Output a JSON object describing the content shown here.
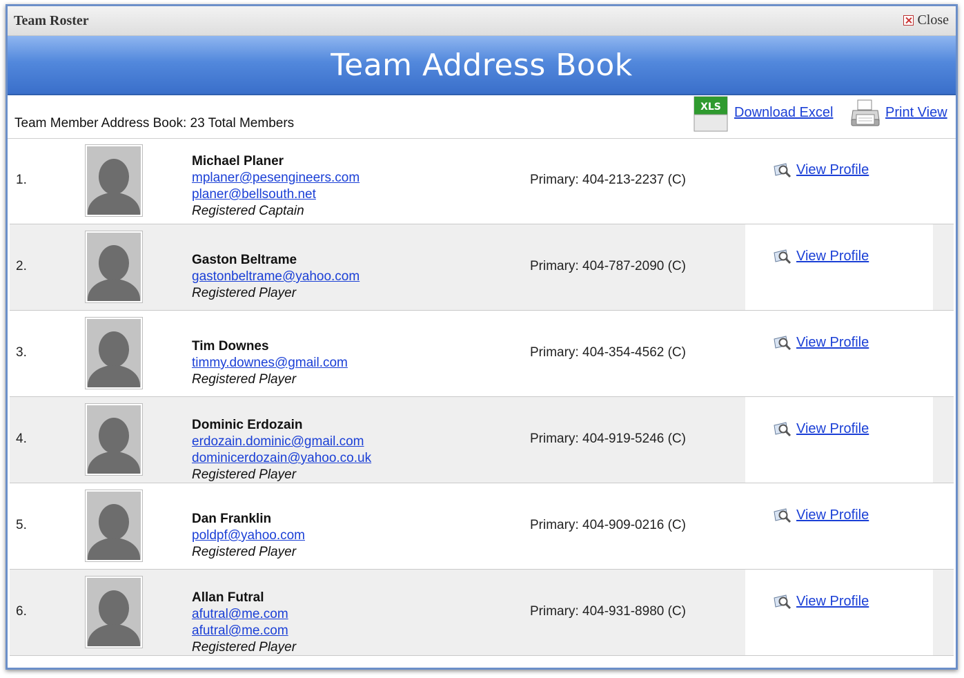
{
  "window": {
    "title": "Team Roster",
    "close_label": "Close"
  },
  "banner": {
    "title": "Team Address Book"
  },
  "toolbar": {
    "summary": "Team Member Address Book: 23 Total Members",
    "xls_badge": "XLS",
    "download_label": "Download Excel",
    "print_label": "Print View"
  },
  "members": [
    {
      "index": "1.",
      "name": "Michael Planer",
      "emails": [
        "mplaner@pesengineers.com",
        "planer@bellsouth.net"
      ],
      "role": "Registered Captain",
      "phone": "Primary: 404-213-2237 (C)",
      "profile_label": "View Profile"
    },
    {
      "index": "2.",
      "name": "Gaston Beltrame",
      "emails": [
        "gastonbeltrame@yahoo.com"
      ],
      "role": "Registered Player",
      "phone": "Primary: 404-787-2090 (C)",
      "profile_label": "View Profile"
    },
    {
      "index": "3.",
      "name": "Tim Downes",
      "emails": [
        "timmy.downes@gmail.com"
      ],
      "role": "Registered Player",
      "phone": "Primary: 404-354-4562 (C)",
      "profile_label": "View Profile"
    },
    {
      "index": "4.",
      "name": "Dominic Erdozain",
      "emails": [
        "erdozain.dominic@gmail.com",
        "dominicerdozain@yahoo.co.uk"
      ],
      "role": "Registered Player",
      "phone": "Primary: 404-919-5246 (C)",
      "profile_label": "View Profile"
    },
    {
      "index": "5.",
      "name": "Dan Franklin",
      "emails": [
        "poldpf@yahoo.com"
      ],
      "role": "Registered Player",
      "phone": "Primary: 404-909-0216 (C)",
      "profile_label": "View Profile"
    },
    {
      "index": "6.",
      "name": "Allan Futral",
      "emails": [
        "afutral@me.com",
        "afutral@me.com"
      ],
      "role": "Registered Player",
      "phone": "Primary: 404-931-8980 (C)",
      "profile_label": "View Profile"
    }
  ]
}
